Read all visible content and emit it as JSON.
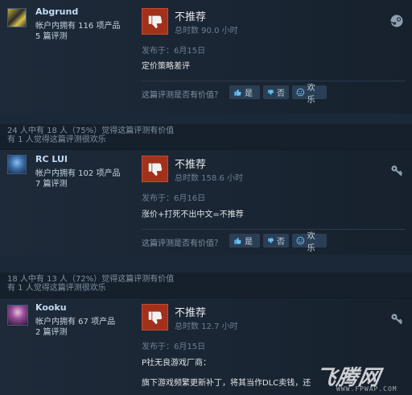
{
  "reviews": [
    {
      "helpful": "",
      "funny": "",
      "user": {
        "name": "Abgrund",
        "products": "帐户内拥有 116 项产品",
        "reviews": "5 篇评测"
      },
      "verdict": "不推荐",
      "hours": "总时数 90.0 小时",
      "posted": "发布于：6月15日",
      "text": [
        "定价策略差评"
      ],
      "vote_question": "这篇评测是否有价值？",
      "yes": "是",
      "no": "否",
      "funny_btn": "欢乐",
      "side_icon": "steam-icon"
    },
    {
      "helpful": "24 人中有 18 人（75%）觉得这篇评测有价值",
      "funny": "有 1 人觉得这篇评测很欢乐",
      "user": {
        "name": "RC LUI",
        "products": "帐户内拥有 102 项产品",
        "reviews": "7 篇评测"
      },
      "verdict": "不推荐",
      "hours": "总时数 158.6 小时",
      "posted": "发布于：6月16日",
      "text": [
        "涨价+打死不出中文=不推荐"
      ],
      "vote_question": "这篇评测是否有价值？",
      "yes": "是",
      "no": "否",
      "funny_btn": "欢乐",
      "side_icon": "key-icon"
    },
    {
      "helpful": "18 人中有 13 人（72%）觉得这篇评测有价值",
      "funny": "有 1 人觉得这篇评测很欢乐",
      "user": {
        "name": "Kooku",
        "products": "帐户内拥有 67 项产品",
        "reviews": "2 篇评测"
      },
      "verdict": "不推荐",
      "hours": "总时数 12.7 小时",
      "posted": "发布于：6月15日",
      "text": [
        "P社无良游戏厂商：",
        "旗下游戏频繁更新补丁，将其当作DLC卖钱，还"
      ],
      "side_icon": "key-icon"
    }
  ],
  "watermark": {
    "brand": "飞腾网",
    "url": "WWW.FPWAP.COM"
  },
  "colors": {
    "background": "#1b2838",
    "thumb_down": "#a2311c",
    "link": "#67c1f5"
  }
}
